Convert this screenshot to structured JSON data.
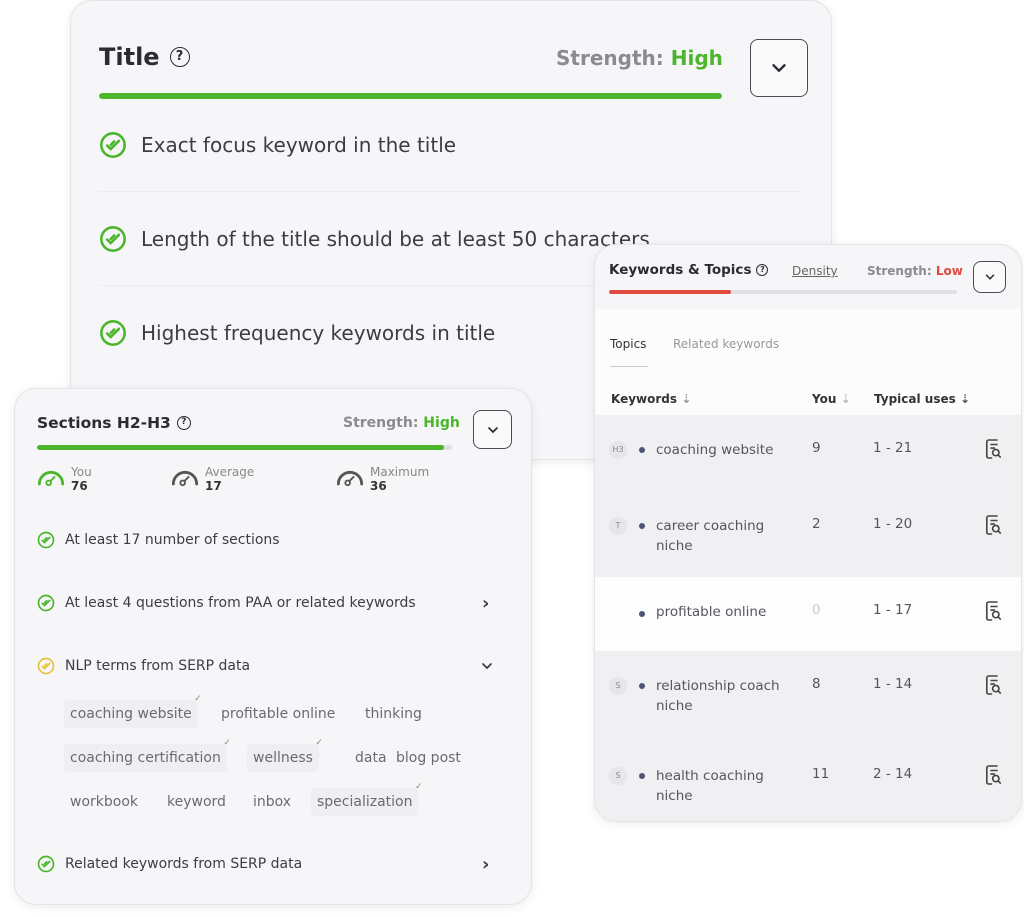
{
  "title_card": {
    "title": "Title",
    "strength_label": "Strength:",
    "strength_value": "High",
    "strength_pct": 100,
    "items": [
      "Exact focus keyword in the title",
      "Length of the title should be at least 50 characters",
      "Highest frequency keywords in title"
    ]
  },
  "sections_card": {
    "title": "Sections H2-H3",
    "strength_label": "Strength:",
    "strength_value": "High",
    "strength_pct": 98,
    "stats": [
      {
        "label": "You",
        "value": "76"
      },
      {
        "label": "Average",
        "value": "17"
      },
      {
        "label": "Maximum",
        "value": "36"
      }
    ],
    "items": [
      {
        "text": "At least 17 number of sections",
        "status": "done"
      },
      {
        "text": "At least 4 questions from PAA or related keywords",
        "status": "done",
        "action": "chevron-right"
      },
      {
        "text": "NLP terms from SERP data",
        "status": "partial",
        "action": "chevron-down"
      },
      {
        "text": "Related keywords from SERP data",
        "status": "done",
        "action": "chevron-right"
      }
    ],
    "nlp_terms": [
      {
        "t": "coaching website",
        "used": true
      },
      {
        "t": "profitable online",
        "used": false
      },
      {
        "t": "thinking",
        "used": false
      },
      {
        "t": "coaching certification",
        "used": true
      },
      {
        "t": "wellness",
        "used": true
      },
      {
        "t": "data",
        "used": false
      },
      {
        "t": "blog post",
        "used": false
      },
      {
        "t": "workbook",
        "used": false
      },
      {
        "t": "keyword",
        "used": false
      },
      {
        "t": "inbox",
        "used": false
      },
      {
        "t": "specialization",
        "used": true
      }
    ]
  },
  "keywords_card": {
    "title": "Keywords & Topics",
    "density_link": "Density",
    "strength_label": "Strength:",
    "strength_value": "Low",
    "strength_pct": 35,
    "tabs": [
      "Topics",
      "Related keywords"
    ],
    "columns": [
      "Keywords",
      "You",
      "Typical uses"
    ],
    "rows": [
      {
        "badge": "H3",
        "keyword": "coaching website",
        "you": "9",
        "typical": "1 - 21"
      },
      {
        "badge": "T",
        "keyword": "career coaching niche",
        "you": "2",
        "typical": "1 - 20"
      },
      {
        "badge": "",
        "keyword": "profitable online",
        "you": "0",
        "typical": "1 - 17"
      },
      {
        "badge": "S",
        "keyword": "relationship coach niche",
        "you": "8",
        "typical": "1 - 14"
      },
      {
        "badge": "S",
        "keyword": "health coaching niche",
        "you": "11",
        "typical": "2 - 14"
      }
    ]
  },
  "colors": {
    "green": "#4bb52b",
    "red": "#e04a3f",
    "partial": "#e8c23a"
  }
}
